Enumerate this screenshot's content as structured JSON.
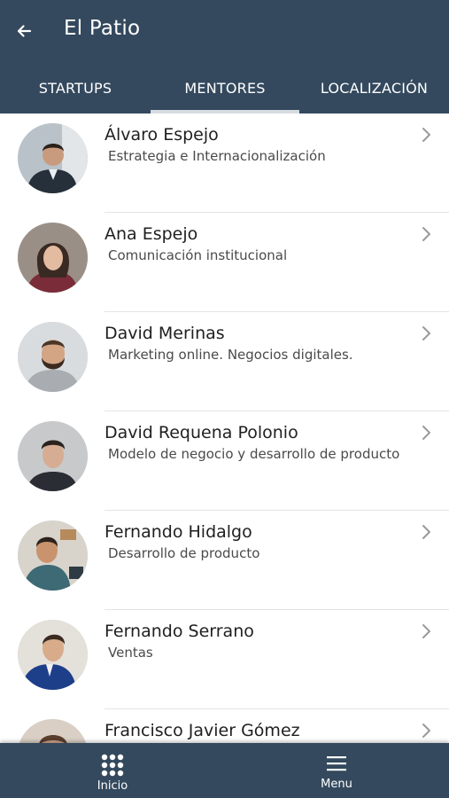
{
  "header": {
    "title": "El Patio",
    "back_icon": "arrow-left-icon",
    "color": "#34495e"
  },
  "tabs": [
    {
      "label": "STARTUPS",
      "active": false
    },
    {
      "label": "MENTORES",
      "active": true
    },
    {
      "label": "LOCALIZACIÓN",
      "active": false
    }
  ],
  "mentors": [
    {
      "name": "Álvaro Espejo",
      "area": "Estrategia e Internacionalización"
    },
    {
      "name": "Ana Espejo",
      "area": "Comunicación institucional"
    },
    {
      "name": "David Merinas",
      "area": "Marketing online. Negocios digitales."
    },
    {
      "name": "David Requena Polonio",
      "area": "Modelo de negocio y desarrollo de producto"
    },
    {
      "name": "Fernando Hidalgo",
      "area": "Desarrollo de producto"
    },
    {
      "name": "Fernando Serrano",
      "area": "Ventas"
    },
    {
      "name": "Francisco Javier Gómez",
      "area": ""
    }
  ],
  "bottom_nav": {
    "inicio_label": "Inicio",
    "inicio_icon": "grid-icon",
    "menu_label": "Menu",
    "menu_icon": "hamburger-menu-icon"
  }
}
